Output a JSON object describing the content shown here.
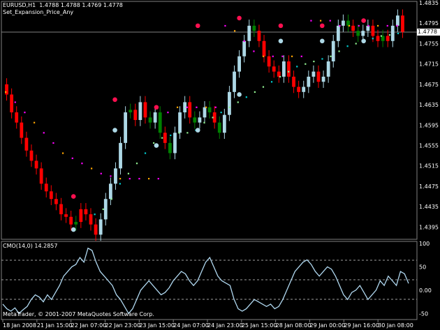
{
  "header": {
    "symbol_line": "EURUSD,H1  1.4788 1.4788 1.4769 1.4778",
    "indicator_name": "Set_Expansion_Price_Any"
  },
  "subwindow": {
    "title": "CMO(14,0) 14.2857"
  },
  "footer": {
    "copyright": "MetaTrader, © 2001-2007 MetaQuotes Software Corp."
  },
  "current_price_label": "1.4778",
  "colors": {
    "background": "#000000",
    "bull_bar": "#add8e6",
    "bear_bar": "#ff0000",
    "neutral_bar": "#008000",
    "stop_up": "#90ee90",
    "stop_up_alt": "#00ced1",
    "stop_down": "#ff00ff",
    "stop_down_alt": "#ffa500",
    "cmo_line": "#b0d8f0",
    "grid": "#808080"
  },
  "chart_data": [
    {
      "type": "candlestick",
      "title": "EURUSD,H1",
      "y_ticks": [
        "1.4835",
        "1.4795",
        "1.4755",
        "1.4715",
        "1.4675",
        "1.4635",
        "1.4595",
        "1.4555",
        "1.4515",
        "1.4475",
        "1.4435",
        "1.4395"
      ],
      "ylim": [
        1.4375,
        1.4835
      ],
      "x_ticks": [
        "18 Jan 2008",
        "21 Jan 15:00",
        "22 Jan 07:00",
        "22 Jan 23:00",
        "23 Jan 15:00",
        "24 Jan 07:00",
        "24 Jan 23:00",
        "25 Jan 15:00",
        "28 Jan 08:00",
        "29 Jan 00:00",
        "29 Jan 16:00",
        "30 Jan 08:00"
      ],
      "current_price": 1.4778,
      "closes": [
        1.4655,
        1.462,
        1.46,
        1.457,
        1.4545,
        1.4525,
        1.451,
        1.448,
        1.4465,
        1.445,
        1.444,
        1.442,
        1.4415,
        1.44,
        1.4405,
        1.443,
        1.442,
        1.44,
        1.438,
        1.441,
        1.445,
        1.448,
        1.451,
        1.456,
        1.462,
        1.4625,
        1.4605,
        1.464,
        1.461,
        1.46,
        1.462,
        1.458,
        1.456,
        1.454,
        1.458,
        1.462,
        1.464,
        1.461,
        1.46,
        1.461,
        1.463,
        1.462,
        1.46,
        1.458,
        1.4615,
        1.466,
        1.47,
        1.473,
        1.476,
        1.479,
        1.478,
        1.476,
        1.473,
        1.471,
        1.47,
        1.469,
        1.472,
        1.469,
        1.467,
        1.466,
        1.467,
        1.469,
        1.47,
        1.468,
        1.469,
        1.472,
        1.476,
        1.479,
        1.48,
        1.479,
        1.478,
        1.477,
        1.478,
        1.479,
        1.477,
        1.476,
        1.477,
        1.476,
        1.479,
        1.481,
        1.4778
      ],
      "bar_colors": [
        "red",
        "red",
        "red",
        "red",
        "red",
        "red",
        "red",
        "red",
        "red",
        "red",
        "red",
        "red",
        "red",
        "red",
        "green",
        "red",
        "red",
        "red",
        "red",
        "blue",
        "blue",
        "blue",
        "blue",
        "blue",
        "blue",
        "green",
        "red",
        "blue",
        "red",
        "green",
        "blue",
        "green",
        "red",
        "green",
        "blue",
        "blue",
        "blue",
        "red",
        "green",
        "blue",
        "blue",
        "green",
        "red",
        "green",
        "blue",
        "blue",
        "blue",
        "blue",
        "blue",
        "blue",
        "green",
        "red",
        "red",
        "red",
        "red",
        "red",
        "blue",
        "red",
        "red",
        "red",
        "blue",
        "blue",
        "blue",
        "red",
        "blue",
        "blue",
        "blue",
        "blue",
        "blue",
        "green",
        "red",
        "green",
        "blue",
        "blue",
        "red",
        "red",
        "green",
        "red",
        "blue",
        "blue",
        "red"
      ],
      "stop_up": [
        1.442,
        1.443,
        1.445,
        1.448,
        1.45,
        1.452,
        1.454,
        1.456,
        1.457,
        1.4575,
        1.458,
        1.458,
        1.4585,
        1.46,
        1.461,
        1.462,
        1.463,
        1.464,
        1.465,
        1.466,
        1.467,
        1.468,
        1.469,
        1.47,
        1.471,
        1.4715,
        1.472,
        1.4725,
        1.473,
        1.474,
        1.475,
        1.4755,
        1.476,
        1.4765,
        1.477,
        1.4772,
        1.4775
      ],
      "stop_down": [
        1.466,
        1.464,
        1.462,
        1.46,
        1.458,
        1.456,
        1.454,
        1.453,
        1.452,
        1.451,
        1.45,
        1.4495,
        1.449,
        1.449,
        1.449,
        1.449,
        1.449,
        1.462,
        1.463,
        1.463,
        1.463,
        1.463,
        1.463,
        1.479,
        1.478,
        1.476,
        1.474,
        1.473,
        1.473,
        1.473,
        1.473,
        1.473,
        1.48,
        1.48,
        1.48,
        1.479,
        1.479,
        1.479,
        1.479,
        1.479,
        1.479,
        1.479
      ],
      "dots_up": [
        1.439,
        1.4585,
        1.4555,
        1.4585,
        1.4655,
        1.476,
        1.476,
        1.476
      ],
      "dots_down": [
        1.4455,
        1.4645,
        1.463,
        1.479,
        1.4805,
        1.479,
        1.479,
        1.48
      ]
    },
    {
      "type": "line",
      "title": "CMO(14,0) 14.2857",
      "series": [
        {
          "name": "CMO(14,0)",
          "values": [
            -30,
            -40,
            -45,
            -38,
            -50,
            -42,
            -35,
            -20,
            -10,
            -15,
            -25,
            -10,
            -20,
            -5,
            10,
            30,
            40,
            50,
            55,
            70,
            60,
            90,
            85,
            60,
            40,
            30,
            20,
            10,
            -10,
            -20,
            -35,
            -50,
            -40,
            -20,
            0,
            10,
            20,
            10,
            0,
            -10,
            -5,
            5,
            20,
            30,
            40,
            35,
            20,
            10,
            20,
            40,
            60,
            70,
            50,
            30,
            20,
            15,
            10,
            -20,
            -40,
            -45,
            -40,
            -30,
            -20,
            -25,
            -30,
            -35,
            -30,
            -40,
            -35,
            -20,
            0,
            20,
            40,
            50,
            60,
            65,
            55,
            40,
            30,
            40,
            50,
            45,
            30,
            10,
            -10,
            -20,
            -5,
            0,
            10,
            -5,
            -20,
            -10,
            0,
            20,
            10,
            30,
            20,
            10,
            40,
            35,
            14.29
          ]
        }
      ],
      "y_ticks": [
        "100",
        "50",
        "0.00",
        "-50"
      ],
      "ylim": [
        -50,
        100
      ]
    }
  ]
}
